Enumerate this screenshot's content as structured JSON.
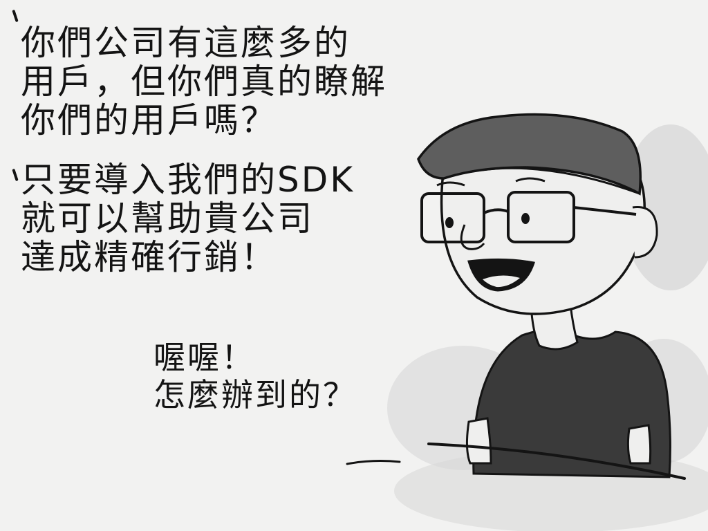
{
  "speech": {
    "customer": [
      "你們公司有這麼多的",
      "用戶，但你們真的瞭解",
      "你們的用戶嗎？"
    ],
    "pitch": [
      "只要導入我們的SDK",
      "就可以幫助貴公司",
      "達成精確行銷！"
    ],
    "reply": [
      "喔喔！",
      "怎麼辦到的？"
    ]
  },
  "colors": {
    "background": "#f2f2f1",
    "ink": "#141414",
    "shirt": "#3a3a3a",
    "cap": "#5e5e5e",
    "skin": "#efefee",
    "shadow": "#c9c9c8"
  }
}
